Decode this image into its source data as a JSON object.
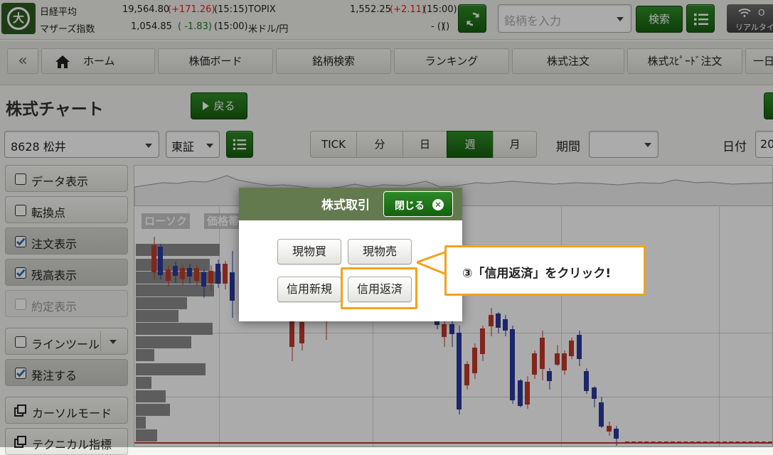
{
  "market": {
    "nikkei_label": "日経平均",
    "nikkei_value": "19,564.80",
    "nikkei_change": "(+171.26)",
    "nikkei_time": "(15:15)",
    "mothers_label": "マザーズ指数",
    "mothers_value": "1,054.85",
    "mothers_change": "( -1.83)",
    "mothers_time": "(15:00)",
    "topix_label": "TOPIX",
    "topix_value": "1,552.25",
    "topix_change": "(+2.11)",
    "topix_time": "(15:00)",
    "usdjpy_label": "米ドル/円",
    "usdjpy_value": "- ()",
    "usdjpy_time": "()"
  },
  "header": {
    "logo_glyph": "大",
    "search_placeholder": "銘柄を入力",
    "search_button": "検索",
    "realtime_label": "リアルタイ",
    "realtime_top": "O"
  },
  "nav": {
    "collapse": "«",
    "items": [
      "ホーム",
      "株価ボード",
      "銘柄検索",
      "ランキング",
      "株式注文",
      "株式ｽﾋﾟｰﾄﾞ注文",
      "一日"
    ]
  },
  "page": {
    "title": "株式チャート",
    "back_button": "戻る",
    "symbol": "8628 松井",
    "exchange": "東証",
    "periods": [
      "TICK",
      "分",
      "日",
      "週",
      "月"
    ],
    "active_period": "週",
    "range_label": "期間",
    "date_label": "日付",
    "date_value": "20"
  },
  "side_panel": [
    {
      "label": "データ表示",
      "checked": false,
      "disabled": false
    },
    {
      "label": "転換点",
      "checked": false,
      "disabled": false
    },
    {
      "label": "注文表示",
      "checked": true,
      "disabled": false
    },
    {
      "label": "残高表示",
      "checked": true,
      "disabled": false
    },
    {
      "label": "約定表示",
      "checked": false,
      "disabled": true
    },
    {
      "label": "ラインツール",
      "checked": false,
      "disabled": false
    },
    {
      "label": "発注する",
      "checked": true,
      "disabled": false
    },
    {
      "label": "カーソルモード",
      "checked": false,
      "disabled": false
    },
    {
      "label": "テクニカル指標",
      "checked": false,
      "disabled": false
    }
  ],
  "chart_tags": [
    "ローソク",
    "価格帯"
  ],
  "modal": {
    "title": "株式取引",
    "close": "閉じる",
    "buttons": [
      "現物買",
      "現物売",
      "信用新規",
      "信用返済"
    ],
    "highlighted": "信用返済"
  },
  "callout": {
    "text": "③「信用返済」をクリック!"
  },
  "colors": {
    "brand_green": "#1f7a18",
    "modal_header": "#637a4f",
    "highlight": "#f2a31b",
    "up": "#d9251d",
    "down": "#1a7f1a"
  }
}
